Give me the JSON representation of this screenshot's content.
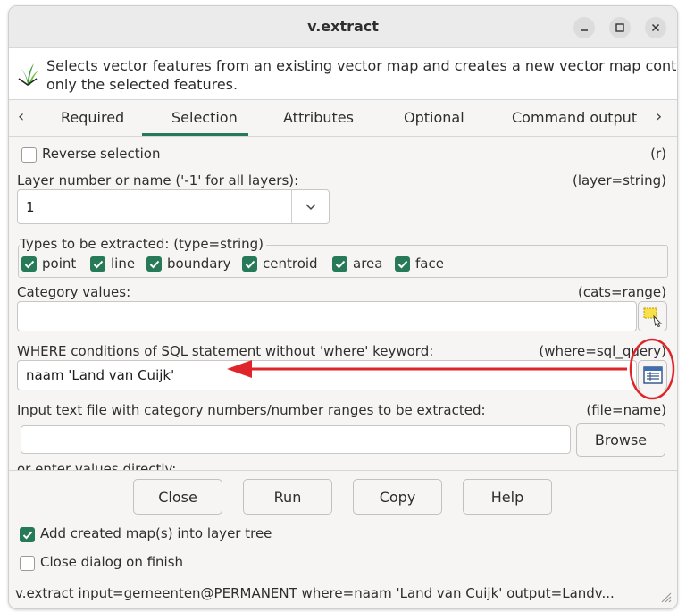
{
  "window": {
    "title": "v.extract",
    "minimize_icon": "minimize-icon",
    "maximize_icon": "maximize-icon",
    "close_icon": "close-icon"
  },
  "description": {
    "icon": "grass-logo-icon",
    "line1": "Selects vector features from an existing vector map and creates a new vector map containi",
    "line2": "only the selected features."
  },
  "tabs": {
    "prev_icon": "chevron-left-icon",
    "next_icon": "chevron-right-icon",
    "items": [
      "Required",
      "Selection",
      "Attributes",
      "Optional",
      "Command output"
    ],
    "active": "Selection"
  },
  "selection": {
    "reverse_label": "Reverse selection",
    "reverse_flag": "(r)",
    "reverse_checked": false,
    "layer_label": "Layer number or name ('-1' for all layers):",
    "layer_param": "(layer=string)",
    "layer_value": "1",
    "types_label": "Types to be extracted:",
    "types_param": "(type=string)",
    "types": [
      {
        "label": "point",
        "checked": true
      },
      {
        "label": "line",
        "checked": true
      },
      {
        "label": "boundary",
        "checked": true
      },
      {
        "label": "centroid",
        "checked": true
      },
      {
        "label": "area",
        "checked": true
      },
      {
        "label": "face",
        "checked": true
      }
    ],
    "cats_label": "Category values:",
    "cats_param": "(cats=range)",
    "cats_value": "",
    "where_label": "WHERE conditions of SQL statement without 'where' keyword:",
    "where_param": "(where=sql_query)",
    "where_value": "naam 'Land van Cuijk'",
    "file_label": "Input text file with category numbers/number ranges to be extracted:",
    "file_param": "(file=name)",
    "file_value": "",
    "browse_label": "Browse",
    "cutoff_label": "or enter values directly:"
  },
  "buttons": {
    "close": "Close",
    "run": "Run",
    "copy": "Copy",
    "help": "Help"
  },
  "options": {
    "add_to_tree_label": "Add created map(s) into layer tree",
    "add_to_tree_checked": true,
    "close_on_finish_label": "Close dialog on finish",
    "close_on_finish_checked": false
  },
  "statusbar": {
    "command": "v.extract input=gemeenten@PERMANENT where=naam 'Land van Cuijk' output=Landv..."
  },
  "colors": {
    "accent": "#267a58",
    "annotation": "#e0252a"
  }
}
